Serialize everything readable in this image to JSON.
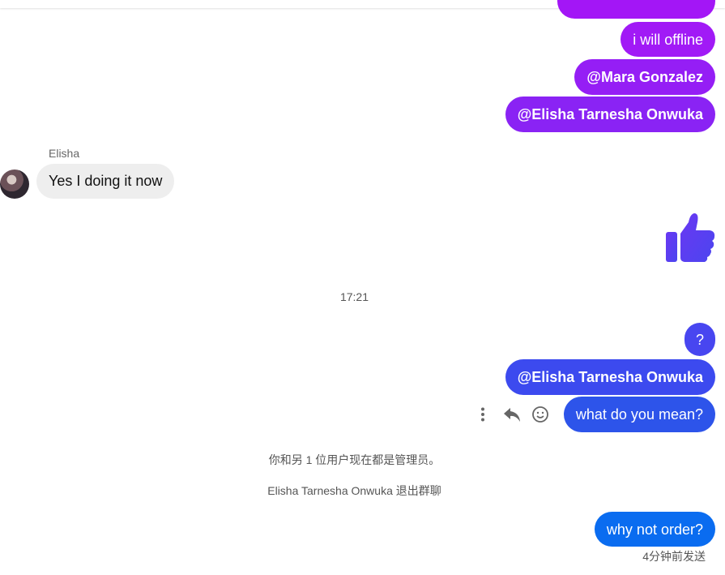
{
  "messages_out_top": [
    {
      "text": "i will offline"
    },
    {
      "text": "@Mara Gonzalez"
    },
    {
      "text": "@Elisha Tarnesha Onwuka"
    }
  ],
  "incoming": {
    "sender": "Elisha",
    "text": "Yes I doing it now",
    "avatar_icon": "user-avatar-photo"
  },
  "reaction_icon": "thumbs-up-icon",
  "timestamp": "17:21",
  "messages_out_bottom": [
    {
      "text": "?"
    },
    {
      "text": "@Elisha Tarnesha Onwuka"
    },
    {
      "text": "what do you mean?"
    }
  ],
  "message_actions": [
    "more-options-icon",
    "reply-icon",
    "emoji-icon"
  ],
  "system_messages": [
    "你和另 1 位用户现在都是管理员。",
    "Elisha Tarnesha Onwuka 退出群聊"
  ],
  "last_message": {
    "text": "why not order?",
    "status": "4分钟前发送"
  },
  "colors": {
    "purple": "#9b19f5",
    "violet": "#7f2af5",
    "indigo": "#4b45f0",
    "blue": "#2c55ea",
    "bright_blue": "#0a6cf0",
    "incoming_bg": "#eeeeee"
  }
}
